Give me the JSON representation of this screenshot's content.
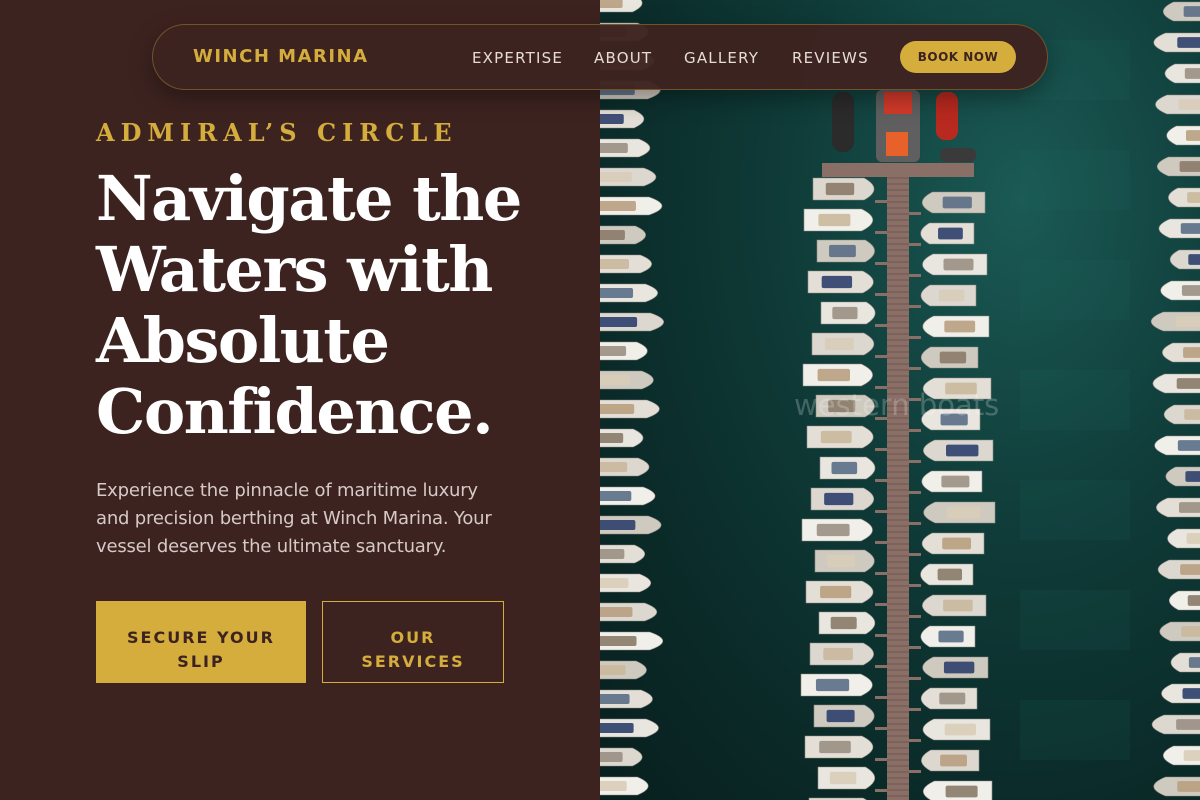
{
  "nav": {
    "brand": "WINCH MARINA",
    "links": [
      {
        "label": "EXPERTISE"
      },
      {
        "label": "ABOUT"
      },
      {
        "label": "GALLERY"
      },
      {
        "label": "REVIEWS"
      }
    ],
    "cta_label": "BOOK NOW"
  },
  "hero": {
    "eyebrow": "ADMIRAL’S CIRCLE",
    "headline": "Navigate the Waters with Absolute Confidence.",
    "description": "Experience the pinnacle of maritime luxury and precision berthing at Winch Marina. Your vessel deserves the ultimate sanctuary.",
    "primary_button": "SECURE YOUR SLIP",
    "secondary_button": "OUR SERVICES"
  },
  "image": {
    "watermark": "western boats"
  },
  "colors": {
    "background": "#3d2320",
    "accent_gold": "#d4ad3c",
    "headline_text": "#ffffff",
    "body_text": "#d6c9c6",
    "water": "#0f3b38"
  }
}
